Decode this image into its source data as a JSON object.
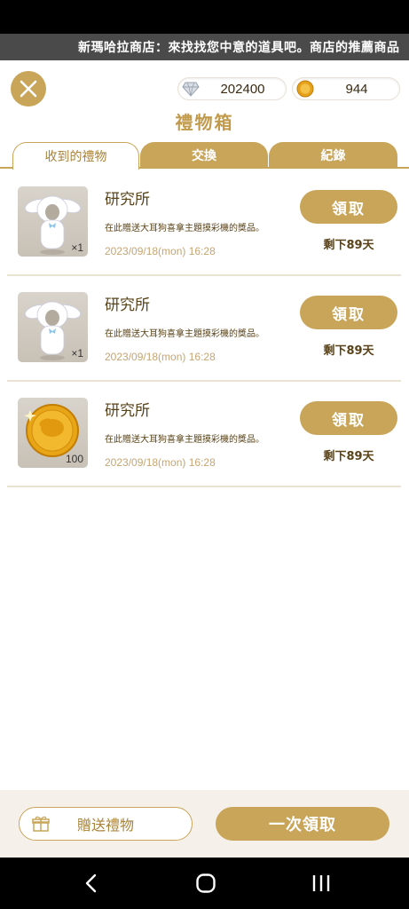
{
  "ticker": {
    "text": "新瑪哈拉商店：來找找您中意的道具吧。商店的推薦商品"
  },
  "header": {
    "title": "禮物箱",
    "diamond_balance": "202400",
    "coin_balance": "944"
  },
  "tabs": [
    {
      "label": "收到的禮物"
    },
    {
      "label": "交換"
    },
    {
      "label": "紀錄"
    }
  ],
  "gifts": [
    {
      "title": "研究所",
      "description": "在此贈送大耳狗喜拿主題摸彩機的獎品。",
      "date": "2023/09/18(mon) 16:28",
      "quantity": "×1",
      "claim_label": "領取",
      "remaining": "剩下89天",
      "item_icon": "cinnamoroll-costume-icon"
    },
    {
      "title": "研究所",
      "description": "在此贈送大耳狗喜拿主題摸彩機的獎品。",
      "date": "2023/09/18(mon) 16:28",
      "quantity": "×1",
      "claim_label": "領取",
      "remaining": "剩下89天",
      "item_icon": "cinnamoroll-costume-icon"
    },
    {
      "title": "研究所",
      "description": "在此贈送大耳狗喜拿主題摸彩機的獎品。",
      "date": "2023/09/18(mon) 16:28",
      "quantity": "100",
      "claim_label": "領取",
      "remaining": "剩下89天",
      "item_icon": "gold-coin-icon"
    }
  ],
  "footer": {
    "send_label": "贈送禮物",
    "claim_all_label": "一次領取"
  },
  "colors": {
    "gold": "#c9a55a",
    "title_gold": "#c19a4c",
    "text_brown": "#5a4318"
  }
}
